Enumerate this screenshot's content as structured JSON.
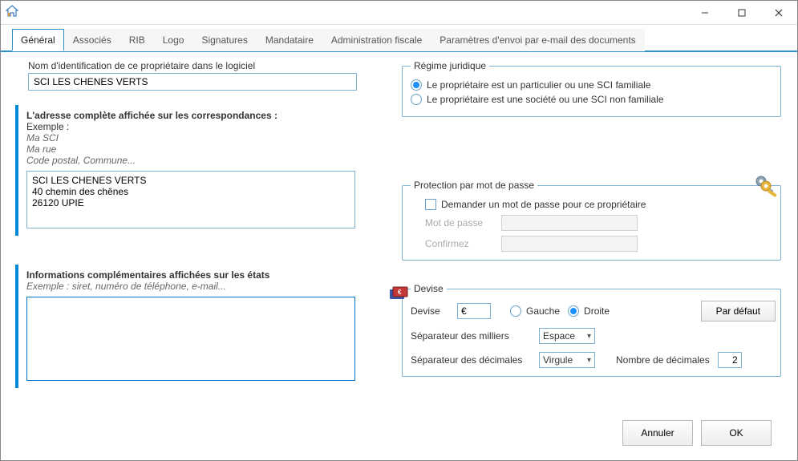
{
  "window": {
    "title": ""
  },
  "tabs": [
    {
      "label": "Général",
      "active": true
    },
    {
      "label": "Associés"
    },
    {
      "label": "RIB"
    },
    {
      "label": "Logo"
    },
    {
      "label": "Signatures"
    },
    {
      "label": "Mandataire"
    },
    {
      "label": "Administration fiscale"
    },
    {
      "label": "Paramètres d'envoi par e-mail des documents"
    }
  ],
  "identification": {
    "label": "Nom d'identification de ce propriétaire dans le logiciel",
    "value": "SCI LES CHENES VERTS"
  },
  "address_block": {
    "title": "L'adresse complète affichée sur les correspondances :",
    "example_label": "Exemple :",
    "example_line1": "Ma SCI",
    "example_line2": "Ma rue",
    "example_line3": "Code postal, Commune...",
    "value": "SCI LES CHENES VERTS\n40 chemin des chênes\n26120 UPIE"
  },
  "info_block": {
    "title": "Informations complémentaires affichées sur les états",
    "example": "Exemple : siret, numéro de téléphone, e-mail...",
    "value": ""
  },
  "regime": {
    "legend": "Régime juridique",
    "option1": "Le propriétaire est un particulier ou une SCI familiale",
    "option2": "Le propriétaire est une société ou une SCI non familiale",
    "selected": 0
  },
  "protection": {
    "legend": "Protection par mot de passe",
    "checkbox_label": "Demander un mot de passe pour ce propriétaire",
    "password_label": "Mot de passe",
    "confirm_label": "Confirmez"
  },
  "devise": {
    "legend": "Devise",
    "default_btn": "Par défaut",
    "devise_label": "Devise",
    "devise_symbol": "€",
    "left_label": "Gauche",
    "right_label": "Droite",
    "position_selected": "right",
    "thousand_label": "Séparateur des milliers",
    "thousand_value": "Espace",
    "decimal_label": "Séparateur des décimales",
    "decimal_value": "Virgule",
    "decimals_count_label": "Nombre de décimales",
    "decimals_count_value": "2"
  },
  "footer": {
    "cancel": "Annuler",
    "ok": "OK"
  }
}
